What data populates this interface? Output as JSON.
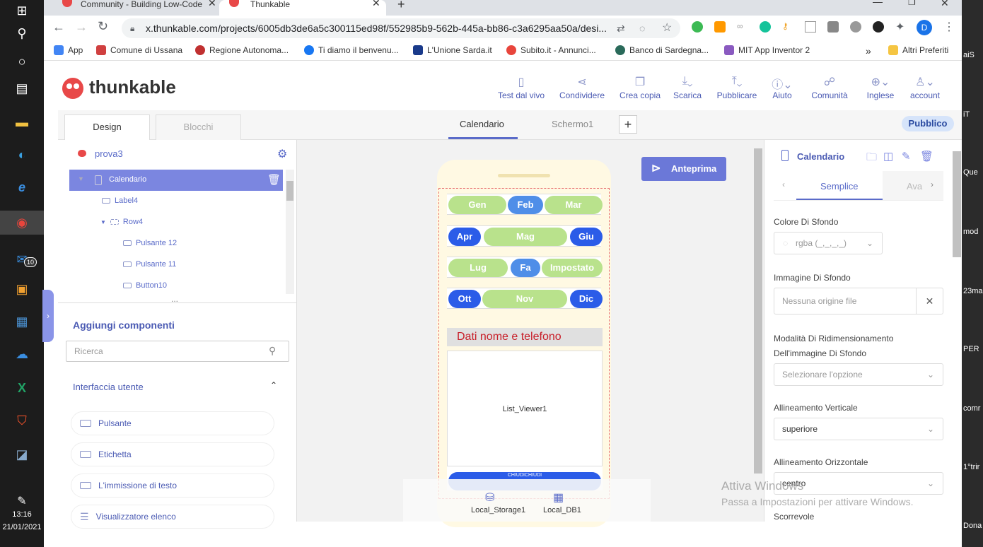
{
  "browser": {
    "tabs": [
      {
        "label": "Community - Building Low-Code"
      },
      {
        "label": "Thunkable"
      }
    ],
    "url": "x.thunkable.com/projects/6005db3de6a5c300115ed98f/552985b9-562b-445a-bb86-c3a6295aa50a/desi...",
    "profile_initial": "D",
    "bookmarks": [
      "App",
      "Comune di Ussana",
      "Regione Autonoma...",
      "Ti diamo il benvenu...",
      "L'Unione Sarda.it",
      "Subito.it - Annunci...",
      "Banco di Sardegna...",
      "MIT App Inventor 2"
    ],
    "bookmarks_more": "»",
    "bookmarks_other": "Altri Preferiti"
  },
  "taskbar": {
    "time": "13:16",
    "date": "21/01/2021",
    "mail_badge": "10"
  },
  "right_strip": [
    "aiS",
    "iT",
    "Que",
    "mod",
    "23ma",
    "PER",
    "comr",
    "1°trir",
    "Dona"
  ],
  "app": {
    "logo": "thunkable",
    "header_buttons": [
      "Test dal vivo",
      "Condividere",
      "Crea copia",
      "Scarica",
      "Pubblicare",
      "Aiuto",
      "Comunità",
      "Inglese",
      "account"
    ],
    "left_tabs": [
      "Design",
      "Blocchi"
    ],
    "center_tabs": [
      "Calendario",
      "Schermo1"
    ],
    "add_screen": "+",
    "public_badge": "Pubblico"
  },
  "tree": {
    "project": "prova3",
    "items": [
      "Calendario",
      "Label4",
      "Row4",
      "Pulsante 12",
      "Pulsante 11",
      "Button10"
    ],
    "more": "..."
  },
  "components": {
    "title": "Aggiungi componenti",
    "search_placeholder": "Ricerca",
    "section": "Interfaccia utente",
    "items": [
      "Pulsante",
      "Etichetta",
      "L'immissione di testo",
      "Visualizzatore elenco"
    ]
  },
  "preview": {
    "button": "Anteprima",
    "months": [
      [
        "Gen",
        "Feb",
        "Mar"
      ],
      [
        "Apr",
        "Mag",
        "Giu"
      ],
      [
        "Lug",
        "Fa",
        "Impostato"
      ],
      [
        "Ott",
        "Nov",
        "Dic"
      ]
    ],
    "header_text": "Dati nome e telefono",
    "list_viewer": "List_Viewer1",
    "close_button": "CHIUDICHIUDI",
    "storage": [
      "Local_Storage1",
      "Local_DB1"
    ]
  },
  "properties": {
    "title": "Calendario",
    "tabs": [
      "Semplice",
      "Ava"
    ],
    "bg_color_label": "Colore Di Sfondo",
    "bg_color_value": "rgba (_,_,_,_)",
    "bg_image_label": "Immagine Di Sfondo",
    "bg_image_value": "Nessuna origine file",
    "resize_label_1": "Modalità Di Ridimensionamento",
    "resize_label_2": "Dell'immagine Di Sfondo",
    "resize_value": "Selezionare l'opzione",
    "valign_label": "Allineamento Verticale",
    "valign_value": "superiore",
    "halign_label": "Allineamento Orizzontale",
    "halign_value": "centro",
    "scroll_label": "Scorrevole"
  },
  "watermark": {
    "line1": "Attiva Windows",
    "line2": "Passa a Impostazioni per attivare Windows."
  }
}
